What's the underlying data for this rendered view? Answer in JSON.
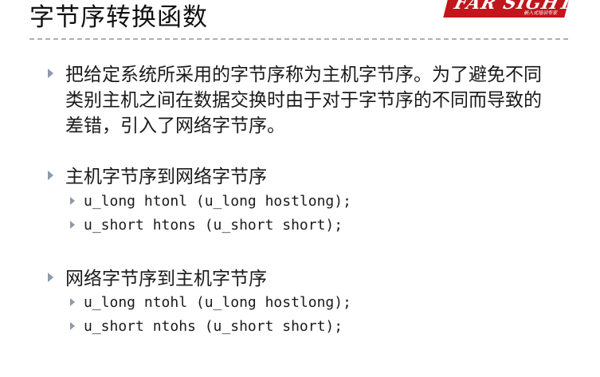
{
  "slide": {
    "title": "字节序转换函数",
    "logo": {
      "text": "FAR SIGHT",
      "subtitle": "嵌入式培训专家"
    },
    "bullets": [
      {
        "text": "把给定系统所采用的字节序称为主机字节序。为了避免不同类别主机之间在数据交换时由于对于字节序的不同而导致的差错，引入了网络字节序。"
      },
      {
        "text": "主机字节序到网络字节序",
        "code": [
          "u_long htonl (u_long hostlong);",
          "u_short htons (u_short short);"
        ]
      },
      {
        "text": "网络字节序到主机字节序",
        "code": [
          "u_long ntohl (u_long hostlong);",
          "u_short ntohs (u_short short);"
        ]
      }
    ]
  }
}
